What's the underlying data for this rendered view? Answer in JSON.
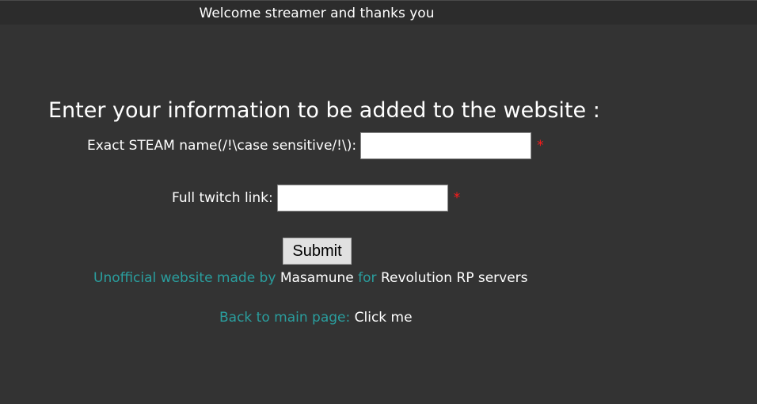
{
  "header": {
    "welcome_text": "Welcome streamer and thanks you"
  },
  "form": {
    "heading": "Enter your information to be added to the website :",
    "steam_label": "Exact STEAM name(/!\\case sensitive/!\\):",
    "steam_value": "",
    "twitch_label": "Full twitch link:",
    "twitch_value": "",
    "required_marker": "*",
    "submit_label": "Submit"
  },
  "footer": {
    "credit_prefix": "Unofficial website made by",
    "credit_author": "Masamune",
    "credit_for": "for",
    "credit_servers": "Revolution RP servers",
    "back_prefix": "Back to main page:",
    "back_link": "Click me"
  },
  "colors": {
    "background": "#333333",
    "accent_teal": "#2a9e9e",
    "required_red": "#ff1a1a"
  }
}
